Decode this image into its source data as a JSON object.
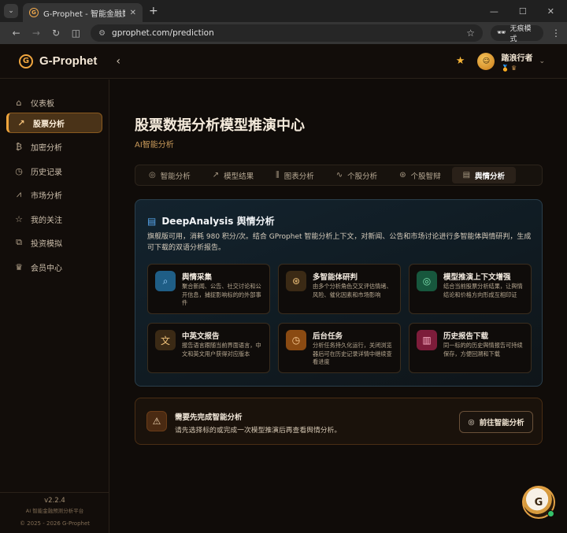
{
  "browser": {
    "tab_title": "G-Prophet - 智能金融数据分析",
    "url": "gprophet.com/prediction",
    "incognito_label": "无痕模式"
  },
  "app": {
    "brand": "G-Prophet",
    "user_name": "踏浪行者"
  },
  "sidebar": {
    "items": [
      {
        "label": "仪表板",
        "icon": "home-icon"
      },
      {
        "label": "股票分析",
        "icon": "trend-icon"
      },
      {
        "label": "加密分析",
        "icon": "bitcoin-icon"
      },
      {
        "label": "历史记录",
        "icon": "history-icon"
      },
      {
        "label": "市场分析",
        "icon": "chart-icon"
      },
      {
        "label": "我的关注",
        "icon": "star-icon"
      },
      {
        "label": "投资模拟",
        "icon": "briefcase-icon"
      },
      {
        "label": "会员中心",
        "icon": "crown-icon"
      }
    ],
    "active_index": 1,
    "version": "v2.2.4",
    "tagline": "AI 智能金融预测分析平台",
    "copyright": "© 2025 - 2026 G-Prophet"
  },
  "page": {
    "title": "股票数据分析模型推演中心",
    "subtitle": "AI智能分析",
    "tabs": [
      {
        "label": "智能分析",
        "icon": "target-icon"
      },
      {
        "label": "模型结果",
        "icon": "trend-icon"
      },
      {
        "label": "图表分析",
        "icon": "bar-chart-icon"
      },
      {
        "label": "个股分析",
        "icon": "pulse-icon"
      },
      {
        "label": "个股智辩",
        "icon": "brain-icon"
      },
      {
        "label": "舆情分析",
        "icon": "newspaper-icon"
      }
    ],
    "active_tab": 5
  },
  "deep_analysis": {
    "title": "DeepAnalysis 舆情分析",
    "description": "旗舰版可用，消耗 980 积分/次。结合 GProphet 智能分析上下文，对新闻、公告和市场讨论进行多智能体舆情研判，生成可下载的双语分析报告。",
    "features": [
      {
        "title": "舆情采集",
        "desc": "聚合新闻、公告、社交讨论和公开信息，捕捉影响标的的外部事件",
        "icon": "search-icon",
        "color": "#1f6fa0"
      },
      {
        "title": "多智能体研判",
        "desc": "由多个分析角色交叉评估情绪、风险、催化因素和市场影响",
        "icon": "brain-icon",
        "color": "#4a3518"
      },
      {
        "title": "模型推演上下文增强",
        "desc": "结合当前股票分析结果，让舆情结论和价格方向形成互相印证",
        "icon": "target-icon",
        "color": "#1c6a4a"
      },
      {
        "title": "中英文报告",
        "desc": "报告语言跟随当前界面语言，中文和英文用户获得对应版本",
        "icon": "translate-icon",
        "color": "#4a3518"
      },
      {
        "title": "后台任务",
        "desc": "分析任务持久化运行，关闭浏览器后可在历史记录详情中继续查看进度",
        "icon": "clock-icon",
        "color": "#8a4c12"
      },
      {
        "title": "历史报告下载",
        "desc": "同一标的的历史舆情报告可持续保存，方便回溯和下载",
        "icon": "document-icon",
        "color": "#8a1f3e"
      }
    ]
  },
  "notice": {
    "title": "需要先完成智能分析",
    "desc": "请先选择标的或完成一次模型推演后再查看舆情分析。",
    "button": "前往智能分析"
  },
  "colors": {
    "accent": "#f0a53c",
    "bg": "#100c09"
  }
}
